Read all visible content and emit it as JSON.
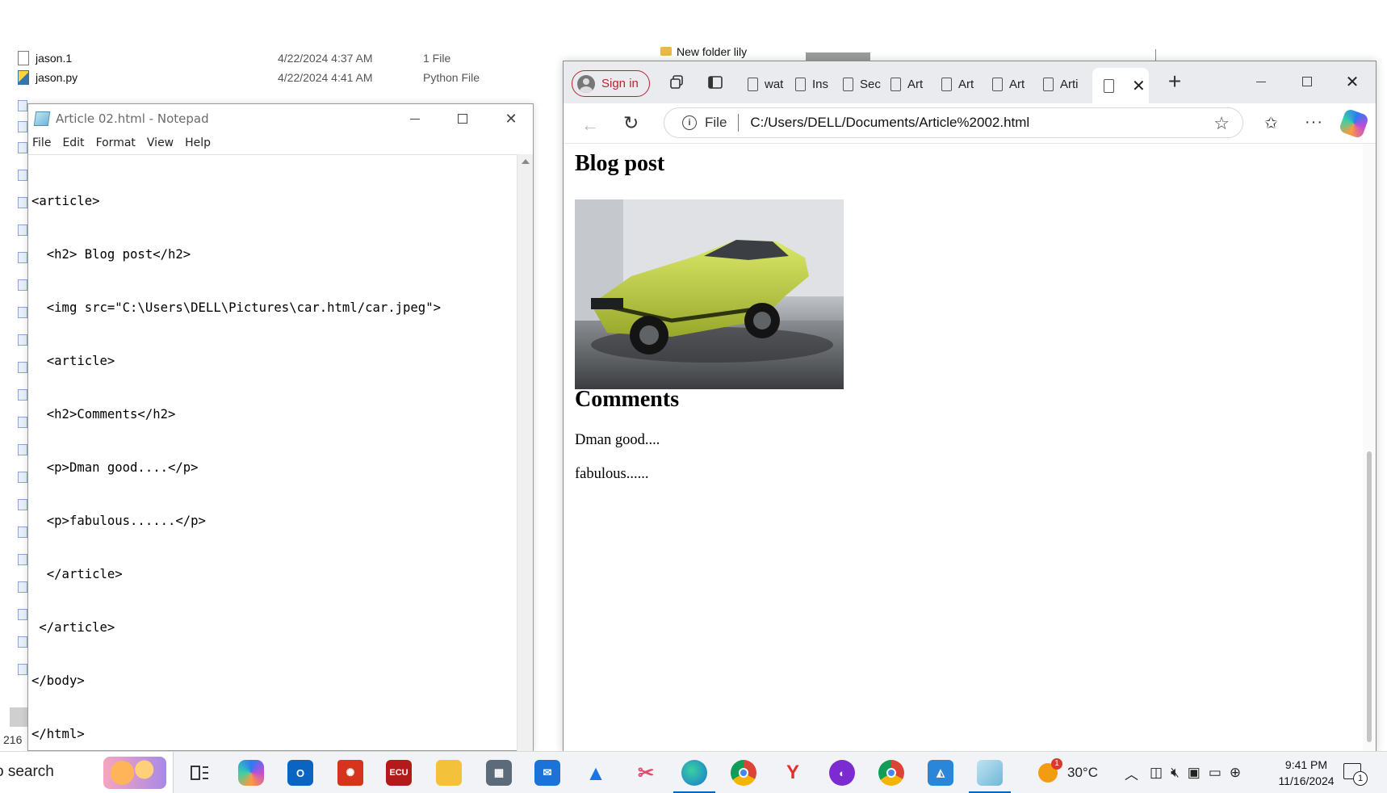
{
  "explorer": {
    "rows": [
      {
        "name": "jason.1",
        "date": "4/22/2024 4:37 AM",
        "type": "1 File"
      },
      {
        "name": "jason.py",
        "date": "4/22/2024 4:41 AM",
        "type": "Python File"
      }
    ],
    "top_folder": "New folder lily",
    "item_count": "216"
  },
  "notepad": {
    "title": "Article 02.html - Notepad",
    "menu": [
      "File",
      "Edit",
      "Format",
      "View",
      "Help"
    ],
    "lines": [
      "<article>",
      "  <h2> Blog post</h2>",
      "  <img src=\"C:\\Users\\DELL\\Pictures\\car.html/car.jpeg\">",
      "  <article>",
      "  <h2>Comments</h2>",
      "  <p>Dman good....</p>",
      "  <p>fabulous......</p>",
      "  </article>",
      " </article>",
      "</body>",
      "</html>"
    ]
  },
  "browser": {
    "signin_label": "Sign in",
    "tabs": [
      "wat",
      "Ins",
      "Sec",
      "Art",
      "Art",
      "Art",
      "Arti"
    ],
    "url_scheme": "File",
    "url": "C:/Users/DELL/Documents/Article%2002.html",
    "page": {
      "heading1": "Blog post",
      "heading2": "Comments",
      "comments": [
        "Dman good....",
        "fabulous......"
      ]
    }
  },
  "taskbar": {
    "search_text": "o search",
    "weather": "30°C",
    "weather_badge": "1",
    "time": "9:41 PM",
    "date": "11/16/2024",
    "notification_count": "1",
    "apps": [
      "task-view",
      "copilot",
      "outlook",
      "app-red",
      "ecu-website",
      "file-explorer",
      "calculator",
      "mail",
      "azure",
      "snipping",
      "edge",
      "chrome",
      "yandex",
      "incognito",
      "chrome-alt",
      "photos",
      "notepad"
    ]
  },
  "colors": {
    "signin_red": "#b3262d",
    "taskbar_active": "#0067c0",
    "car_body": "#c6d84a"
  }
}
